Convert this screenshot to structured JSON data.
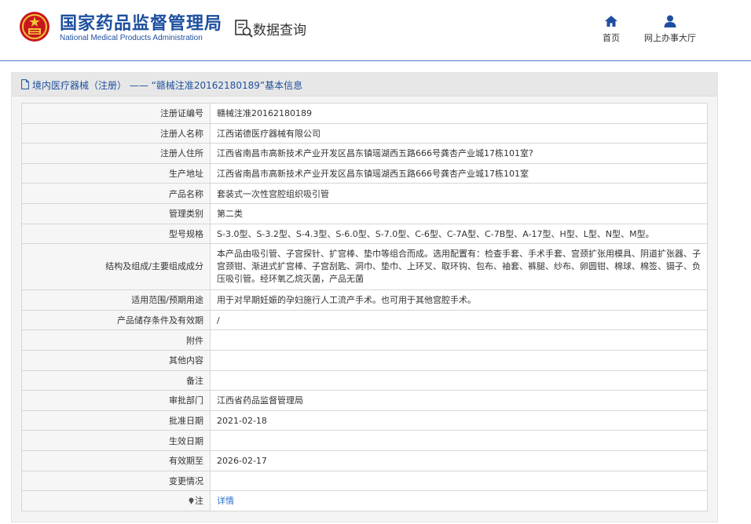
{
  "header": {
    "brand_cn": "国家药品监督管理局",
    "brand_en": "National Medical Products Administration",
    "query_label": "数据查询",
    "nav": [
      {
        "label": "首页",
        "icon": "home-icon"
      },
      {
        "label": "网上办事大厅",
        "icon": "user-icon"
      }
    ]
  },
  "panel": {
    "category": "境内医疗器械（注册）",
    "separator": " —— ",
    "title_suffix": "“赣械注准20162180189”基本信息"
  },
  "rows": [
    {
      "label": "注册证编号",
      "value": "赣械注准20162180189"
    },
    {
      "label": "注册人名称",
      "value": "江西诺德医疗器械有限公司"
    },
    {
      "label": "注册人住所",
      "value": "江西省南昌市高新技术产业开发区昌东镇瑶湖西五路666号龚杏产业城17栋101室?"
    },
    {
      "label": "生产地址",
      "value": "江西省南昌市高新技术产业开发区昌东镇瑶湖西五路666号龚杏产业城17栋101室"
    },
    {
      "label": "产品名称",
      "value": "套装式一次性宫腔组织吸引管"
    },
    {
      "label": "管理类别",
      "value": "第二类"
    },
    {
      "label": "型号规格",
      "value": "S-3.0型、S-3.2型、S-4.3型、S-6.0型、S-7.0型、C-6型、C-7A型、C-7B型、A-17型、H型、L型、N型、M型。"
    },
    {
      "label": "结构及组成/主要组成成分",
      "value": "本产品由吸引管、子宫探针、扩宫棒、垫巾等组合而成。选用配置有：检查手套、手术手套、宫颈扩张用模具、阴道扩张器、子宫颈钳、渐进式扩宫棒、子宫刮匙、洞巾、垫巾、上环叉、取环钩、包布、袖套、裤腿、纱布、卵圆钳、棉球、棉签、镊子、负压吸引管。经环氧乙烷灭菌，产品无菌"
    },
    {
      "label": "适用范围/预期用途",
      "value": "用于对早期妊娠的孕妇施行人工流产手术。也可用于其他宫腔手术。"
    },
    {
      "label": "产品储存条件及有效期",
      "value": "/"
    },
    {
      "label": "附件",
      "value": ""
    },
    {
      "label": "其他内容",
      "value": ""
    },
    {
      "label": "备注",
      "value": ""
    },
    {
      "label": "审批部门",
      "value": "江西省药品监督管理局"
    },
    {
      "label": "批准日期",
      "value": "2021-02-18"
    },
    {
      "label": "生效日期",
      "value": ""
    },
    {
      "label": "有效期至",
      "value": "2026-02-17"
    },
    {
      "label": "变更情况",
      "value": ""
    },
    {
      "label": "注",
      "value": "详情",
      "link": true
    }
  ],
  "colors": {
    "brand_blue": "#1d4f9e",
    "link_blue": "#2a6fc9",
    "emblem_red": "#c8161d",
    "emblem_gold": "#f3c43a"
  }
}
